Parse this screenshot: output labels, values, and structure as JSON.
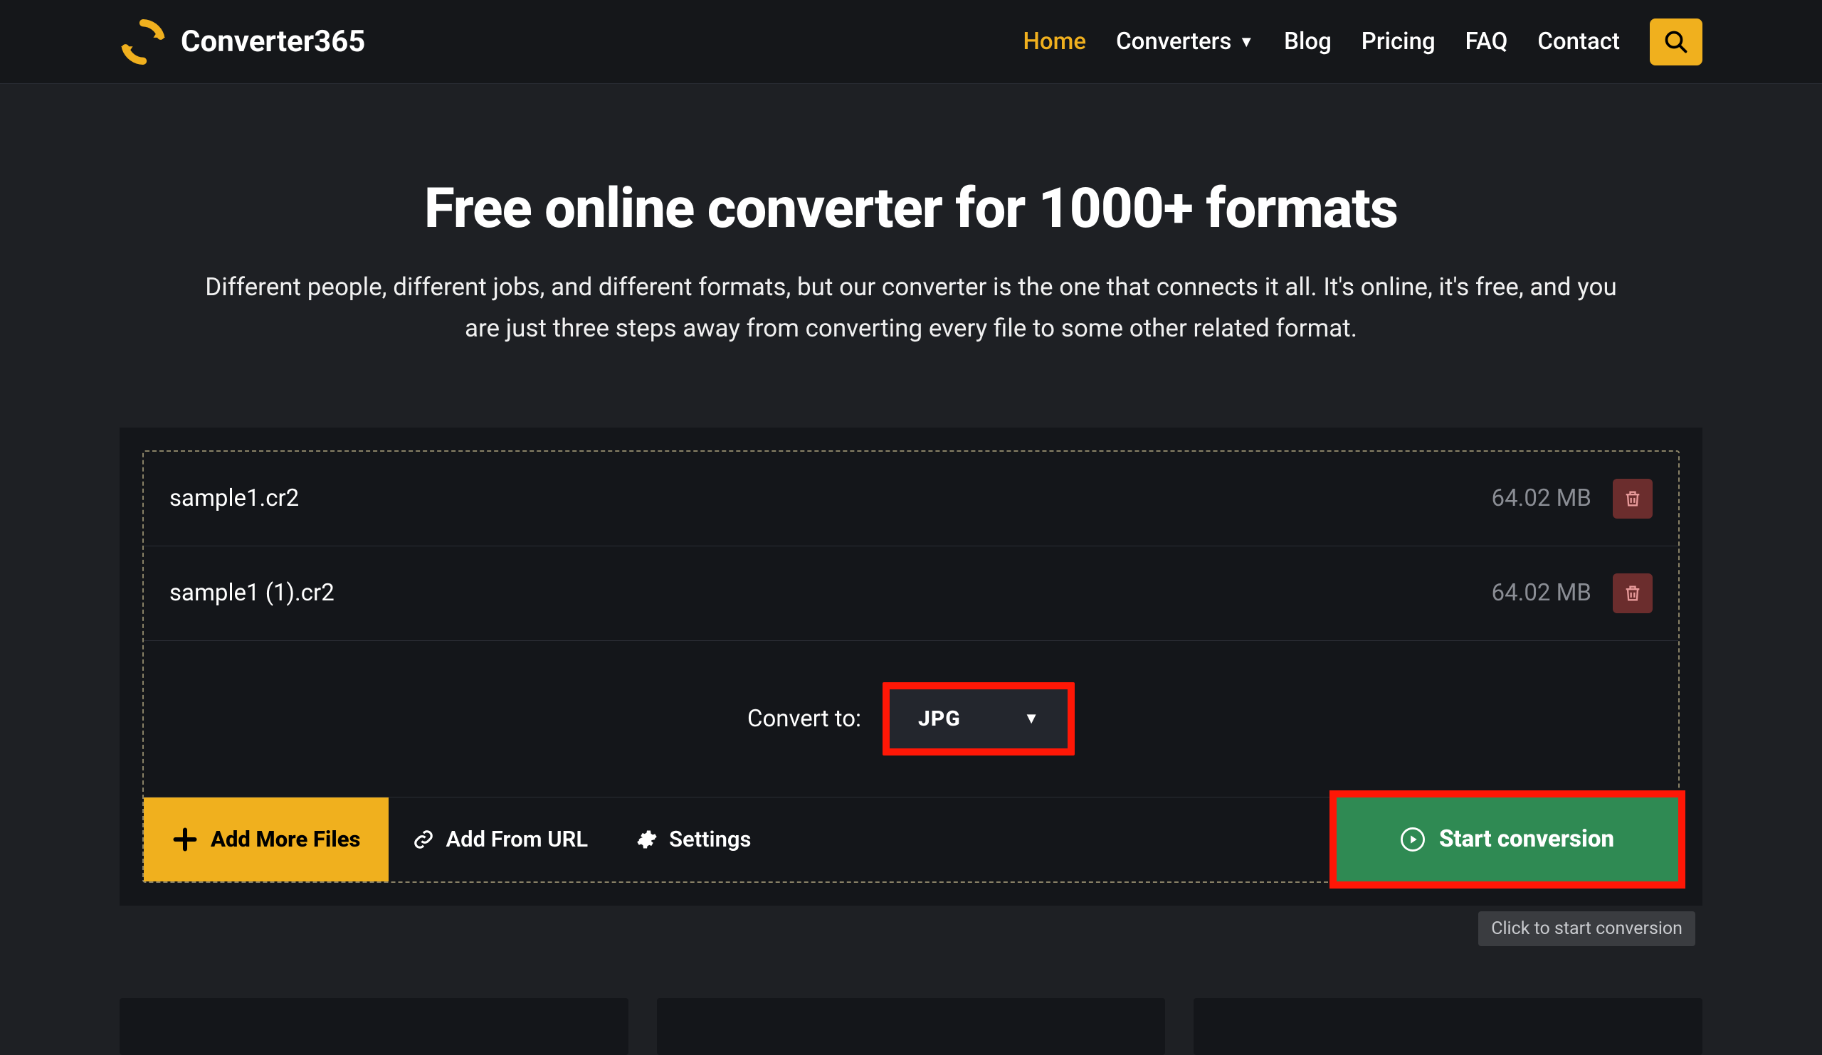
{
  "brand": {
    "name": "Converter365"
  },
  "nav": {
    "home": "Home",
    "converters": "Converters",
    "blog": "Blog",
    "pricing": "Pricing",
    "faq": "FAQ",
    "contact": "Contact"
  },
  "hero": {
    "title": "Free online converter for 1000+ formats",
    "subtitle": "Different people, different jobs, and different formats, but our converter is the one that connects it all. It's online, it's free, and you are just three steps away from converting every file to some other related format."
  },
  "files": [
    {
      "name": "sample1.cr2",
      "size": "64.02 MB"
    },
    {
      "name": "sample1 (1).cr2",
      "size": "64.02 MB"
    }
  ],
  "convert": {
    "label": "Convert to:",
    "format": "JPG"
  },
  "actions": {
    "add_more": "Add More Files",
    "add_url": "Add From URL",
    "settings": "Settings",
    "start": "Start conversion"
  },
  "tooltip": "Click to start conversion",
  "colors": {
    "accent": "#f0b01e",
    "highlight": "#ff1706",
    "success": "#2f8a53"
  }
}
